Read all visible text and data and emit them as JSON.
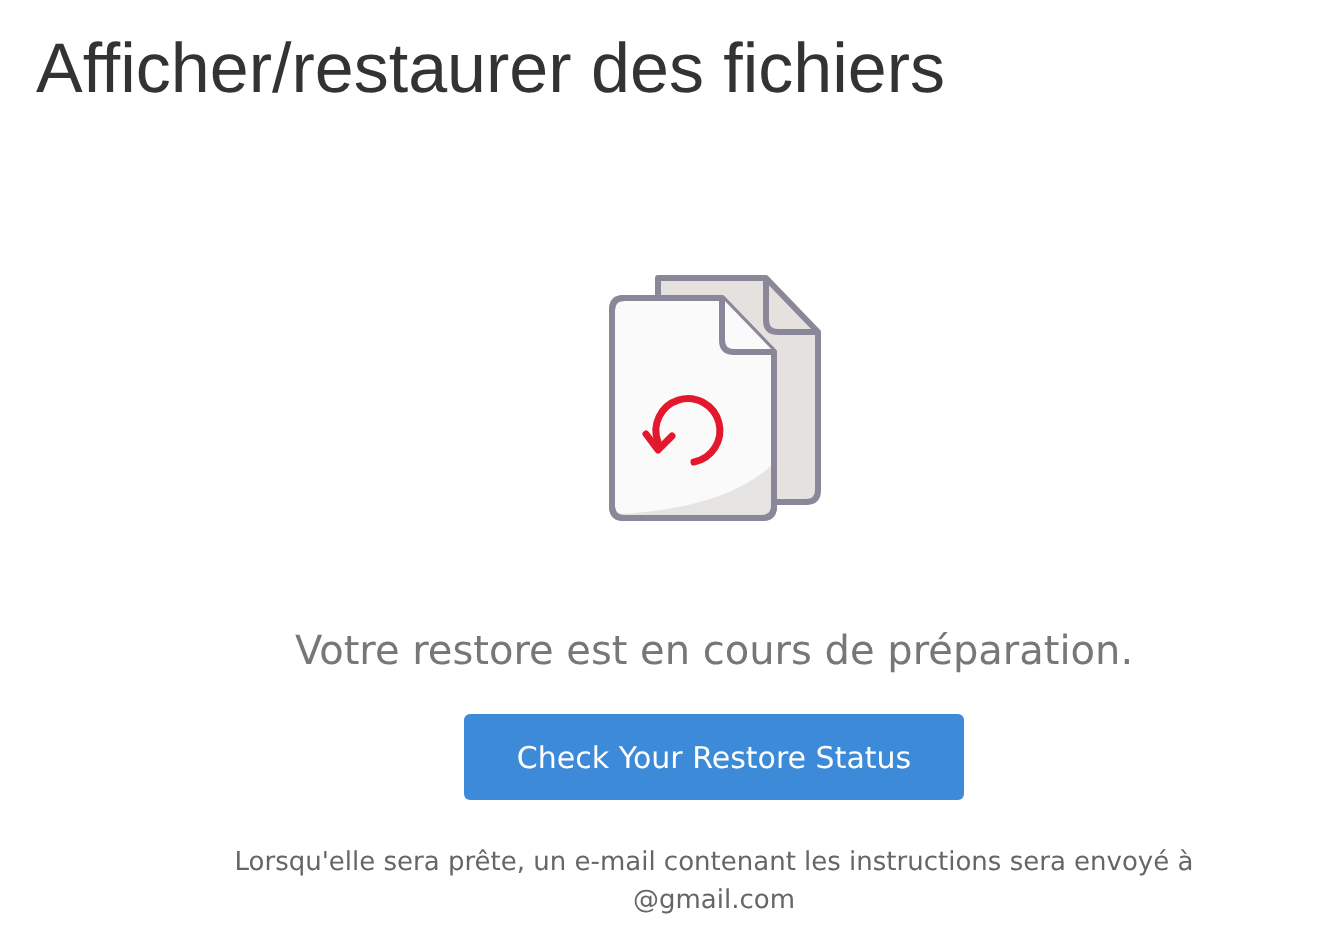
{
  "page": {
    "title": "Afficher/restaurer des fichiers"
  },
  "status": {
    "message": "Votre restore est en cours de préparation.",
    "button": "Check Your Restore Status"
  },
  "notice": {
    "text": "Lorsqu'elle sera prête, un e-mail contenant les instructions sera envoyé à",
    "email": "@gmail.com"
  }
}
